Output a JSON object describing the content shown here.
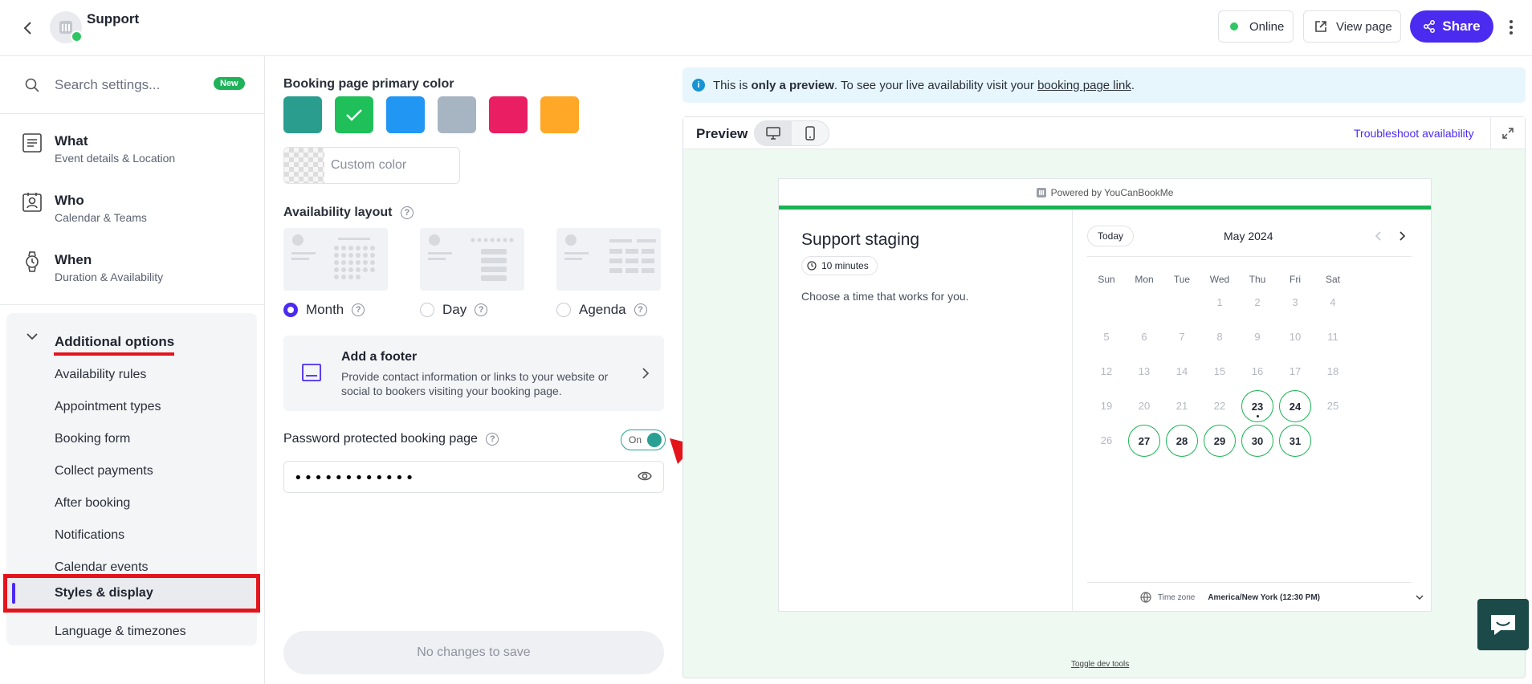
{
  "header": {
    "title": "Support",
    "online_label": "Online",
    "view_page_label": "View page",
    "share_label": "Share",
    "colors": {
      "online": "#2fc763",
      "share": "#4b2bf0"
    }
  },
  "sidebar": {
    "search_placeholder": "Search settings...",
    "new_badge": "New",
    "items": [
      {
        "title": "What",
        "subtitle": "Event details & Location",
        "icon": "details-icon"
      },
      {
        "title": "Who",
        "subtitle": "Calendar & Teams",
        "icon": "team-icon"
      },
      {
        "title": "When",
        "subtitle": "Duration & Availability",
        "icon": "watch-icon"
      }
    ],
    "additional_options": {
      "label": "Additional options",
      "items": [
        "Availability rules",
        "Appointment types",
        "Booking form",
        "Collect payments",
        "After booking",
        "Notifications",
        "Calendar events",
        "Styles & display",
        "Language & timezones"
      ],
      "active": "Styles & display"
    }
  },
  "styles": {
    "primary_color_label": "Booking page primary color",
    "swatches": [
      "#2a9d8f",
      "#1fbf5a",
      "#2196f3",
      "#a7b4c2",
      "#e91e63",
      "#ffa726"
    ],
    "selected_swatch": 1,
    "custom_color_placeholder": "Custom color",
    "layout_label": "Availability layout",
    "layouts": [
      "Month",
      "Day",
      "Agenda"
    ],
    "selected_layout": "Month",
    "footer_title": "Add a footer",
    "footer_desc": "Provide contact information or links to your website or social to bookers visiting your booking page.",
    "password_label": "Password protected booking page",
    "password_toggle": "On",
    "password_value": "••••••••••••",
    "save_label": "No changes to save"
  },
  "preview": {
    "banner_pre": "This is ",
    "banner_bold": "only a preview",
    "banner_mid": ". To see your live availability visit your ",
    "banner_link": "booking page link",
    "banner_end": ".",
    "title": "Preview",
    "troubleshoot_label": "Troubleshoot availability",
    "powered_by": "Powered by YouCanBookMe",
    "booking_title": "Support staging",
    "duration": "10 minutes",
    "description": "Choose a time that works for you.",
    "today_label": "Today",
    "month_label": "May 2024",
    "weekdays": [
      "Sun",
      "Mon",
      "Tue",
      "Wed",
      "Thu",
      "Fri",
      "Sat"
    ],
    "weeks": [
      [
        "",
        "",
        "",
        "1",
        "2",
        "3",
        "4"
      ],
      [
        "5",
        "6",
        "7",
        "8",
        "9",
        "10",
        "11"
      ],
      [
        "12",
        "13",
        "14",
        "15",
        "16",
        "17",
        "18"
      ],
      [
        "19",
        "20",
        "21",
        "22",
        "23",
        "24",
        "25"
      ],
      [
        "26",
        "27",
        "28",
        "29",
        "30",
        "31",
        ""
      ]
    ],
    "available_days": [
      "23",
      "24",
      "27",
      "28",
      "29",
      "30",
      "31"
    ],
    "today_day": "23",
    "timezone_label": "Time zone",
    "timezone_value": "America/New York (12:30 PM)",
    "dev_tools_label": "Toggle dev tools"
  }
}
